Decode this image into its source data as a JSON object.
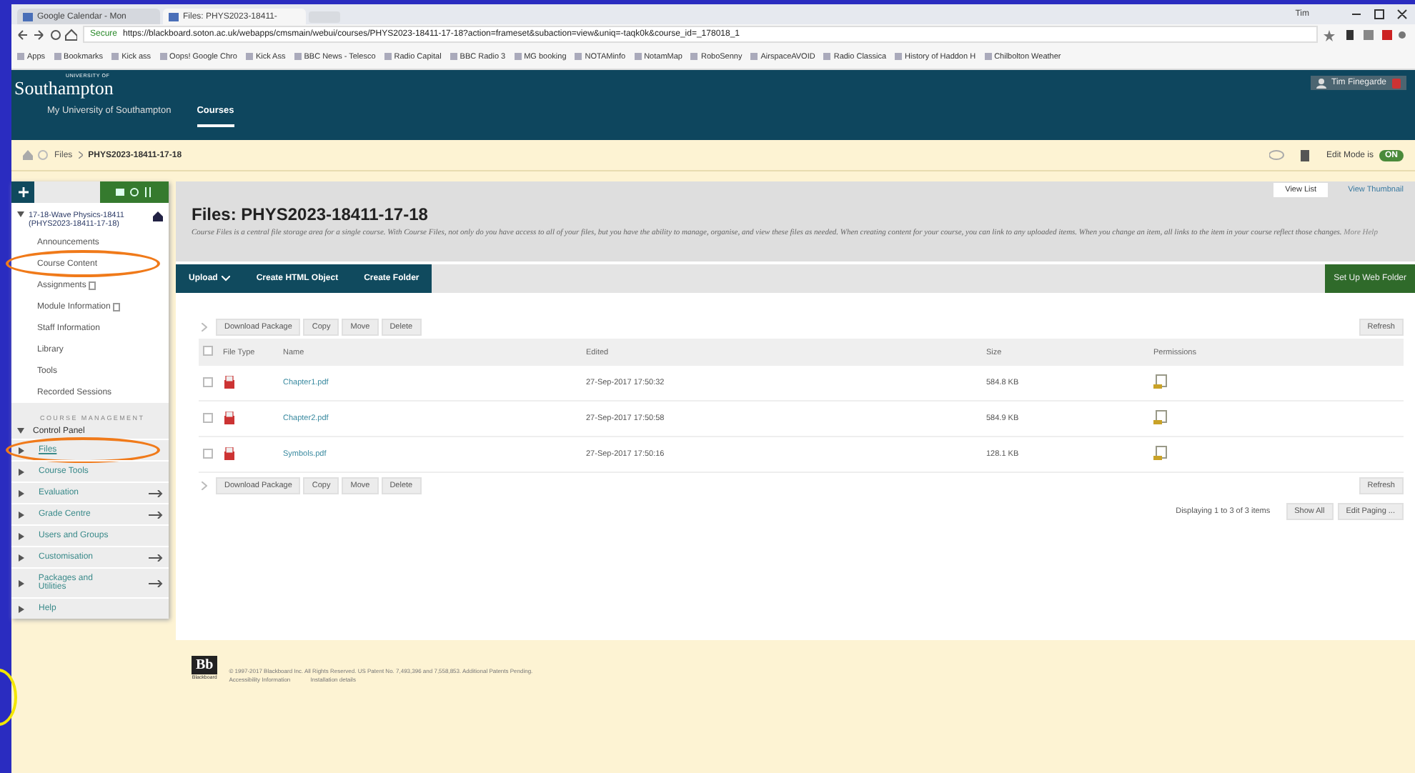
{
  "browser": {
    "tabs": [
      {
        "title": "Google Calendar - Mon",
        "selected": false
      },
      {
        "title": "Files: PHYS2023-18411-",
        "selected": true
      }
    ],
    "profile": "Tim",
    "secure_label": "Secure",
    "url": "https://blackboard.soton.ac.uk/webapps/cmsmain/webui/courses/PHYS2023-18411-17-18?action=frameset&subaction=view&uniq=-taqk0k&course_id=_178018_1",
    "bookmarks": [
      "Apps",
      "Bookmarks",
      "Kick ass",
      "Oops! Google Chro",
      "Kick Ass",
      "BBC News - Telesco",
      "Radio Capital",
      "BBC Radio 3",
      "MG booking",
      "NOTAMinfo",
      "NotamMap",
      "RoboSenny",
      "AirspaceAVOID",
      "Radio Classica",
      "History of Haddon H",
      "Chilbolton Weather"
    ]
  },
  "header": {
    "logo_small": "UNIVERSITY OF",
    "logo": "Southampton",
    "nav": [
      {
        "label": "My University of Southampton",
        "selected": false
      },
      {
        "label": "Courses",
        "selected": true
      }
    ],
    "user": "Tim Finegarde"
  },
  "breadcrumb": [
    "Files",
    "PHYS2023-18411-17-18"
  ],
  "edit_mode": {
    "label": "Edit Mode is",
    "toggle": "ON",
    "on": true
  },
  "sidebar": {
    "course": "17-18-Wave Physics-18411 (PHYS2023-18411-17-18)",
    "items": [
      {
        "label": "Announcements",
        "icon": false,
        "circled": false
      },
      {
        "label": "Course Content",
        "icon": false,
        "circled": true
      },
      {
        "label": "Assignments",
        "icon": true,
        "circled": false
      },
      {
        "label": "Module Information",
        "icon": true,
        "circled": false
      },
      {
        "label": "Staff Information",
        "icon": false,
        "circled": false
      },
      {
        "label": "Library",
        "icon": false,
        "circled": false
      },
      {
        "label": "Tools",
        "icon": false,
        "circled": false
      },
      {
        "label": "Recorded Sessions",
        "icon": false,
        "circled": false
      }
    ],
    "management_title": "COURSE MANAGEMENT",
    "control_panel": {
      "label": "Control Panel",
      "expanded": true,
      "children": [
        {
          "label": "Files",
          "arrow": false,
          "circled": true
        },
        {
          "label": "Course Tools",
          "arrow": false,
          "circled": false
        },
        {
          "label": "Evaluation",
          "arrow": true,
          "circled": false
        },
        {
          "label": "Grade Centre",
          "arrow": true,
          "circled": false
        },
        {
          "label": "Users and Groups",
          "arrow": false,
          "circled": false
        },
        {
          "label": "Customisation",
          "arrow": true,
          "circled": false
        },
        {
          "label": "Packages and Utilities",
          "arrow": true,
          "circled": false
        },
        {
          "label": "Help",
          "arrow": false,
          "circled": false
        }
      ]
    }
  },
  "page": {
    "title": "Files: PHYS2023-18411-17-18",
    "description": "Course Files is a central file storage area for a single course. With Course Files, not only do you have access to all of your files, but you have the ability to manage, organise, and view these files as needed. When creating content for your course, you can link to any uploaded items. When you change an item, all links to the item in your course reflect those changes.",
    "help_link": "More Help",
    "views": [
      {
        "label": "View List",
        "selected": true
      },
      {
        "label": "View Thumbnail",
        "selected": false
      }
    ],
    "actions": [
      {
        "label": "Upload",
        "dropdown": true
      },
      {
        "label": "Create HTML Object",
        "dropdown": false
      },
      {
        "label": "Create Folder",
        "dropdown": false
      }
    ],
    "web_folder": "Set Up Web Folder",
    "bulk_actions_top": [
      "Download Package",
      "Copy",
      "Move",
      "Delete"
    ],
    "refresh_top": "Refresh",
    "select_all_checked": false,
    "columns": [
      "File Type",
      "Name",
      "Edited",
      "Size",
      "Permissions"
    ],
    "rows": [
      {
        "checked": false,
        "name": "Chapter1.pdf",
        "edited": "27-Sep-2017 17:50:32",
        "size": "584.8 KB"
      },
      {
        "checked": false,
        "name": "Chapter2.pdf",
        "edited": "27-Sep-2017 17:50:58",
        "size": "584.9 KB"
      },
      {
        "checked": false,
        "name": "Symbols.pdf",
        "edited": "27-Sep-2017 17:50:16",
        "size": "128.1 KB"
      }
    ],
    "bulk_actions_bottom": [
      "Download Package",
      "Copy",
      "Move",
      "Delete"
    ],
    "refresh_bottom": "Refresh",
    "paging": "Displaying 1 to 3 of 3 items",
    "paging_buttons": [
      "Show All",
      "Edit Paging ..."
    ]
  },
  "footer": {
    "logo": "Bb",
    "logo_caption": "Blackboard",
    "copyright": "© 1997-2017 Blackboard Inc. All Rights Reserved. US Patent No. 7,493,396 and 7,558,853. Additional Patents Pending.",
    "links": [
      "Accessibility Information",
      "Installation details"
    ]
  }
}
